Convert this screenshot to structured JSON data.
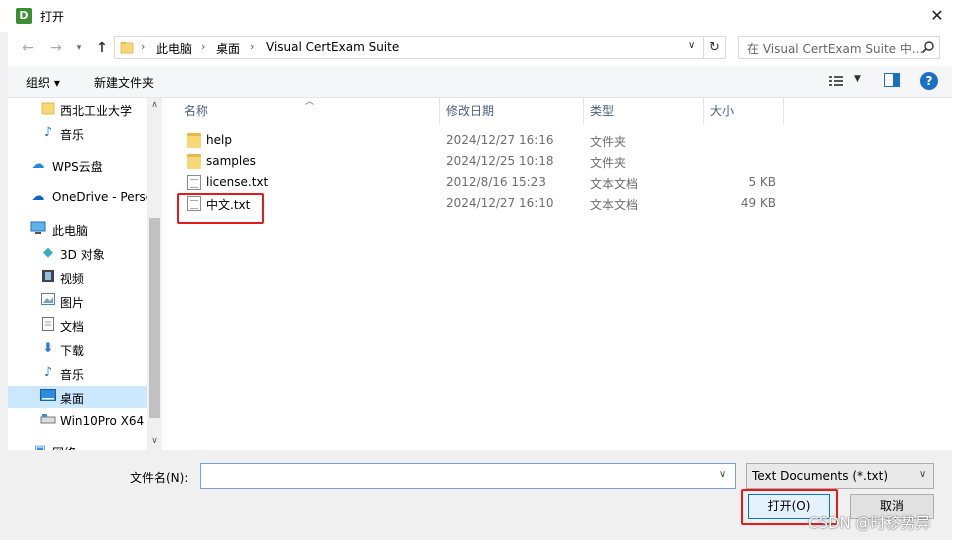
{
  "window": {
    "title": "打开",
    "app_icon_letter": "D",
    "close_glyph": "✕"
  },
  "address": {
    "crumbs": [
      "此电脑",
      "桌面",
      "Visual CertExam Suite"
    ],
    "search_placeholder": "在 Visual CertExam Suite 中..."
  },
  "toolbar": {
    "organize_label": "组织 ▾",
    "new_folder_label": "新建文件夹",
    "help_label": "?"
  },
  "nav": {
    "items": [
      {
        "label": "西北工业大学",
        "icon": "folder-icon"
      },
      {
        "label": "音乐",
        "icon": "music-icon"
      },
      {
        "label": "WPS云盘",
        "icon": "cloud-icon"
      },
      {
        "label": "OneDrive - Perso",
        "icon": "onedrive-icon"
      },
      {
        "label": "此电脑",
        "icon": "computer-icon"
      },
      {
        "label": "3D 对象",
        "icon": "cube-icon"
      },
      {
        "label": "视频",
        "icon": "video-icon"
      },
      {
        "label": "图片",
        "icon": "picture-icon"
      },
      {
        "label": "文档",
        "icon": "document-icon"
      },
      {
        "label": "下载",
        "icon": "download-icon"
      },
      {
        "label": "音乐",
        "icon": "music-icon"
      },
      {
        "label": "桌面",
        "icon": "desktop-icon"
      },
      {
        "label": "Win10Pro X64",
        "icon": "drive-icon"
      },
      {
        "label": "网络",
        "icon": "network-icon"
      }
    ],
    "selected_index": 11
  },
  "columns": {
    "name": "名称",
    "date": "修改日期",
    "type": "类型",
    "size": "大小"
  },
  "files": [
    {
      "name": "help",
      "date": "2024/12/27 16:16",
      "type": "文件夹",
      "size": "",
      "kind": "folder"
    },
    {
      "name": "samples",
      "date": "2024/12/25 10:18",
      "type": "文件夹",
      "size": "",
      "kind": "folder"
    },
    {
      "name": "license.txt",
      "date": "2012/8/16 15:23",
      "type": "文本文档",
      "size": "5 KB",
      "kind": "txt"
    },
    {
      "name": "中文.txt",
      "date": "2024/12/27 16:10",
      "type": "文本文档",
      "size": "49 KB",
      "kind": "txt"
    }
  ],
  "bottom": {
    "filename_label": "文件名(N):",
    "filename_value": "",
    "filetype_value": "Text Documents (*.txt)",
    "open_label": "打开(O)",
    "cancel_label": "取消"
  },
  "watermark": "CSDN @时移势异",
  "colors": {
    "accent": "#0078d7",
    "selection": "#cce8ff",
    "highlight_box": "#e21c1c"
  }
}
